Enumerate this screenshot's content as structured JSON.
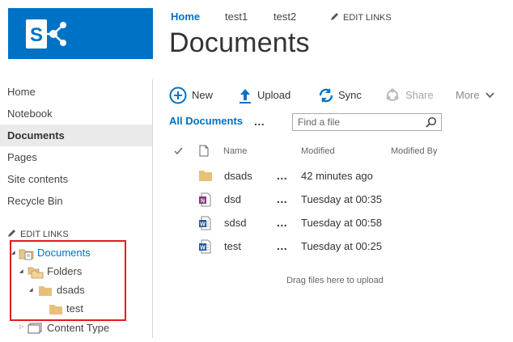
{
  "brand_color": "#0072c6",
  "highlight_color": "#e31b23",
  "logo": {
    "icon": "sharepoint-logo-icon"
  },
  "topnav": {
    "items": [
      "Home",
      "test1",
      "test2"
    ],
    "active": "Home",
    "edit_links": "EDIT LINKS"
  },
  "page_title": "Documents",
  "sidebar": {
    "items": [
      "Home",
      "Notebook",
      "Documents",
      "Pages",
      "Site contents",
      "Recycle Bin"
    ],
    "selected": "Documents",
    "edit_links": "EDIT LINKS"
  },
  "tree": {
    "root": "Documents",
    "folders": "Folders",
    "subfolder": "dsads",
    "leaf": "test",
    "content_type": "Content Type"
  },
  "commands": {
    "new": "New",
    "upload": "Upload",
    "sync": "Sync",
    "share": "Share",
    "more": "More"
  },
  "views": {
    "current": "All Documents",
    "more": "...",
    "search_placeholder": "Find a file"
  },
  "columns": {
    "name": "Name",
    "modified": "Modified",
    "modified_by": "Modified By"
  },
  "documents": [
    {
      "name": "dsads",
      "type": "folder",
      "modified": "42 minutes ago",
      "icon": "folder-icon"
    },
    {
      "name": "dsd",
      "type": "onenote",
      "modified": "Tuesday at 00:35",
      "icon": "onenote-icon"
    },
    {
      "name": "sdsd",
      "type": "word",
      "modified": "Tuesday at 00:58",
      "icon": "word-doc-icon"
    },
    {
      "name": "test",
      "type": "word",
      "modified": "Tuesday at 00:25",
      "icon": "word-doc-icon"
    }
  ],
  "row_menu": "...",
  "dropzone": "Drag files here to upload"
}
